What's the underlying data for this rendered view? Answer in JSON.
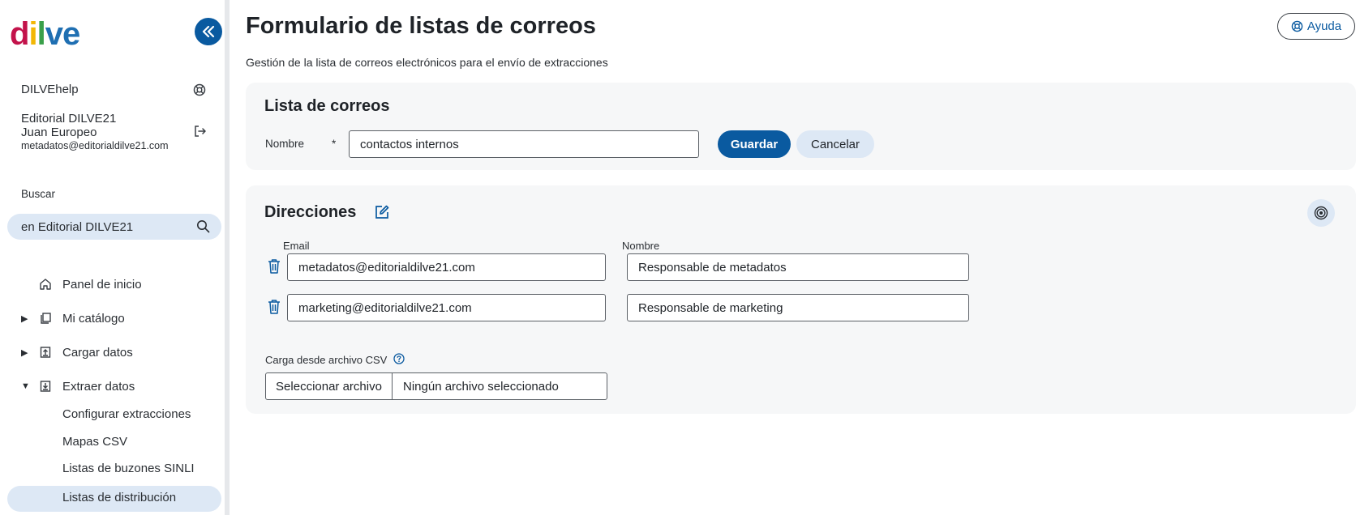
{
  "sidebar": {
    "logo": {
      "d": "d",
      "i": "i",
      "l": "l",
      "v": "v",
      "e": "e"
    },
    "help_item": "DILVEhelp",
    "user": {
      "org": "Editorial DILVE21",
      "name": "Juan Europeo",
      "email": "metadatos@editorialdilve21.com"
    },
    "search_label": "Buscar",
    "search_value": "en Editorial DILVE21",
    "nav": [
      {
        "label": "Panel de inicio"
      },
      {
        "label": "Mi catálogo"
      },
      {
        "label": "Cargar datos"
      },
      {
        "label": "Extraer datos"
      }
    ],
    "sub_items": [
      {
        "label": "Configurar extracciones"
      },
      {
        "label": "Mapas CSV"
      },
      {
        "label": "Listas de buzones SINLI"
      },
      {
        "label": "Listas de distribución"
      }
    ]
  },
  "header": {
    "title": "Formulario de listas de correos",
    "subtitle": "Gestión de la lista de correos electrónicos para el envío de extracciones",
    "help_label": "Ayuda"
  },
  "list_card": {
    "title": "Lista de correos",
    "name_label": "Nombre",
    "required_mark": "*",
    "name_value": "contactos internos",
    "save_label": "Guardar",
    "cancel_label": "Cancelar"
  },
  "addresses_card": {
    "title": "Direcciones",
    "email_header": "Email",
    "name_header": "Nombre",
    "rows": [
      {
        "email": "metadatos@editorialdilve21.com",
        "name": "Responsable de metadatos"
      },
      {
        "email": "marketing@editorialdilve21.com",
        "name": "Responsable de marketing"
      }
    ],
    "csv_label": "Carga desde archivo CSV",
    "file_button": "Seleccionar archivo",
    "file_status": "Ningún archivo seleccionado"
  },
  "colors": {
    "primary": "#0a5aa0",
    "light_blue": "#dde8f5",
    "card_bg": "#f6f7f8"
  }
}
